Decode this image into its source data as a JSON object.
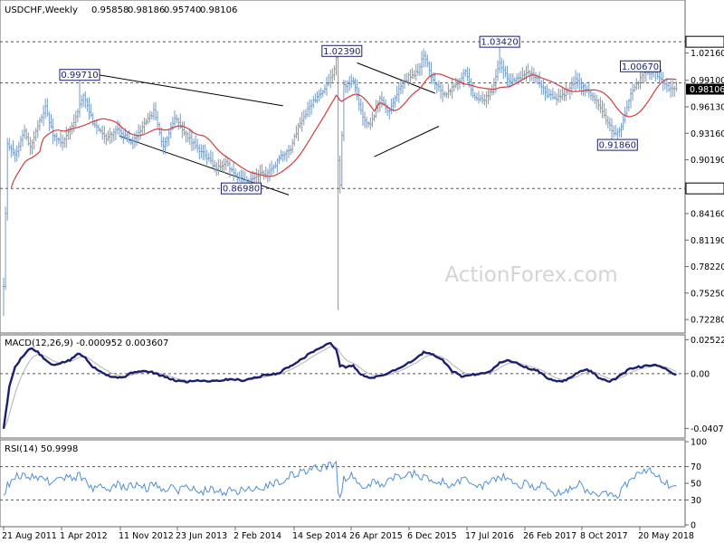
{
  "chart_data": {
    "type": "bar",
    "title": "USDCHF,Weekly",
    "ohlc": {
      "open": "0.95858",
      "high": "0.98186",
      "low": "0.95740",
      "close": "0.98106"
    },
    "watermark": "ActionForex.com",
    "x_labels": [
      "21 Aug 2011",
      "1 Apr 2012",
      "11 Nov 2012",
      "23 Jun 2013",
      "2 Feb 2014",
      "14 Sep 2014",
      "26 Apr 2015",
      "6 Dec 2015",
      "17 Jul 2016",
      "26 Feb 2017",
      "8 Oct 2017",
      "20 May 2018"
    ],
    "price": {
      "type": "ohlc-bar",
      "ylim": [
        0.7097,
        1.0587
      ],
      "ticks": [
        "1.03420",
        "1.02160",
        "0.99100",
        "0.96130",
        "0.93160",
        "0.90190",
        "0.86980",
        "0.84160",
        "0.81190",
        "0.78220",
        "0.75250",
        "0.72280"
      ],
      "current_price": "0.98106",
      "current_price_color": "#000000",
      "levels": [
        {
          "value": 1.0342,
          "label": "1.03420"
        },
        {
          "value": 0.9881,
          "label": ""
        },
        {
          "value": 0.8698,
          "label": "0.86980"
        }
      ],
      "annotations": [
        {
          "label": "0.99710",
          "week": 40,
          "value": 0.9971
        },
        {
          "label": "1.02390",
          "week": 178,
          "value": 1.0239
        },
        {
          "label": "1.03420",
          "week": 261,
          "value": 1.0342
        },
        {
          "label": "1.00670",
          "week": 335,
          "value": 1.0067
        },
        {
          "label": "0.91860",
          "week": 323,
          "value": 0.9186
        },
        {
          "label": "0.86980",
          "week": 125,
          "value": 0.8698
        }
      ],
      "trendlines": [
        {
          "from": [
            50,
            0.9971
          ],
          "to": [
            147,
            0.9625
          ]
        },
        {
          "from": [
            61,
            0.9285
          ],
          "to": [
            150,
            0.8625
          ]
        },
        {
          "from": [
            186,
            1.0105
          ],
          "to": [
            227,
            0.9765
          ]
        },
        {
          "from": [
            195,
            0.9053
          ],
          "to": [
            229,
            0.9395
          ]
        }
      ],
      "ma_label": "moving average",
      "series_color": "#7a9bbf",
      "ma_color": "#d43c3c",
      "anchors": [
        [
          0,
          0.761
        ],
        [
          2,
          0.92
        ],
        [
          6,
          0.907
        ],
        [
          11,
          0.935
        ],
        [
          14,
          0.915
        ],
        [
          18,
          0.94
        ],
        [
          22,
          0.961
        ],
        [
          26,
          0.93
        ],
        [
          31,
          0.92
        ],
        [
          37,
          0.945
        ],
        [
          42,
          0.976
        ],
        [
          47,
          0.944
        ],
        [
          54,
          0.925
        ],
        [
          60,
          0.938
        ],
        [
          67,
          0.92
        ],
        [
          72,
          0.935
        ],
        [
          79,
          0.956
        ],
        [
          84,
          0.916
        ],
        [
          90,
          0.95
        ],
        [
          96,
          0.93
        ],
        [
          102,
          0.915
        ],
        [
          107,
          0.905
        ],
        [
          112,
          0.891
        ],
        [
          117,
          0.9
        ],
        [
          122,
          0.883
        ],
        [
          128,
          0.878
        ],
        [
          133,
          0.885
        ],
        [
          139,
          0.887
        ],
        [
          146,
          0.905
        ],
        [
          151,
          0.915
        ],
        [
          156,
          0.944
        ],
        [
          162,
          0.965
        ],
        [
          168,
          0.98
        ],
        [
          173,
          0.995
        ],
        [
          175,
          1.015
        ],
        [
          176,
          0.9
        ],
        [
          177,
          0.875
        ],
        [
          179,
          0.985
        ],
        [
          184,
          0.99
        ],
        [
          189,
          0.95
        ],
        [
          193,
          0.94
        ],
        [
          198,
          0.97
        ],
        [
          203,
          0.955
        ],
        [
          208,
          0.98
        ],
        [
          213,
          0.995
        ],
        [
          218,
          1.0
        ],
        [
          221,
          1.02
        ],
        [
          226,
          0.99
        ],
        [
          232,
          0.975
        ],
        [
          238,
          0.985
        ],
        [
          243,
          1.0
        ],
        [
          248,
          0.97
        ],
        [
          253,
          0.97
        ],
        [
          257,
          0.98
        ],
        [
          261,
          1.01
        ],
        [
          266,
          0.99
        ],
        [
          271,
          0.992
        ],
        [
          276,
          1.0
        ],
        [
          281,
          0.992
        ],
        [
          286,
          0.975
        ],
        [
          291,
          0.97
        ],
        [
          296,
          0.977
        ],
        [
          301,
          0.992
        ],
        [
          306,
          0.981
        ],
        [
          309,
          0.975
        ],
        [
          314,
          0.96
        ],
        [
          317,
          0.948
        ],
        [
          321,
          0.93
        ],
        [
          325,
          0.938
        ],
        [
          329,
          0.97
        ],
        [
          333,
          0.987
        ],
        [
          337,
          0.999
        ],
        [
          342,
          1.0
        ],
        [
          347,
          0.988
        ],
        [
          350,
          0.982
        ],
        [
          354,
          0.981
        ]
      ]
    },
    "macd": {
      "label": "MACD(12,26,9) -0.000952 0.003607",
      "ylim": [
        -0.0465,
        0.0275
      ],
      "ticks": [
        "0.025224",
        "0.00",
        "-0.040702"
      ],
      "main_color": "#1a1f6e",
      "signal_color": "#b3b3b3",
      "anchors": [
        [
          0,
          -0.0407
        ],
        [
          3,
          -0.01
        ],
        [
          6,
          0.005
        ],
        [
          10,
          0.013
        ],
        [
          14,
          0.019
        ],
        [
          18,
          0.016
        ],
        [
          22,
          0.01
        ],
        [
          26,
          0.006
        ],
        [
          30,
          0.008
        ],
        [
          35,
          0.01
        ],
        [
          39,
          0.015
        ],
        [
          43,
          0.012
        ],
        [
          47,
          0.005
        ],
        [
          52,
          0.001
        ],
        [
          56,
          -0.002
        ],
        [
          60,
          -0.003
        ],
        [
          64,
          -0.002
        ],
        [
          68,
          0.001
        ],
        [
          72,
          0.002
        ],
        [
          78,
          0.001
        ],
        [
          84,
          -0.002
        ],
        [
          90,
          -0.005
        ],
        [
          96,
          -0.006
        ],
        [
          102,
          -0.005
        ],
        [
          108,
          -0.0055
        ],
        [
          114,
          -0.005
        ],
        [
          120,
          -0.004
        ],
        [
          126,
          -0.005
        ],
        [
          132,
          -0.003
        ],
        [
          138,
          -0.001
        ],
        [
          144,
          0.0
        ],
        [
          150,
          0.005
        ],
        [
          156,
          0.01
        ],
        [
          162,
          0.016
        ],
        [
          168,
          0.02
        ],
        [
          172,
          0.023
        ],
        [
          175,
          0.018
        ],
        [
          177,
          0.006
        ],
        [
          180,
          0.005
        ],
        [
          184,
          0.006
        ],
        [
          188,
          -0.001
        ],
        [
          193,
          -0.003
        ],
        [
          198,
          -0.002
        ],
        [
          203,
          0.001
        ],
        [
          208,
          0.004
        ],
        [
          213,
          0.008
        ],
        [
          218,
          0.012
        ],
        [
          221,
          0.016
        ],
        [
          226,
          0.014
        ],
        [
          231,
          0.01
        ],
        [
          236,
          0.002
        ],
        [
          241,
          -0.002
        ],
        [
          246,
          -0.001
        ],
        [
          251,
          0.0
        ],
        [
          256,
          0.002
        ],
        [
          261,
          0.008
        ],
        [
          266,
          0.01
        ],
        [
          271,
          0.007
        ],
        [
          276,
          0.004
        ],
        [
          281,
          0.002
        ],
        [
          286,
          -0.003
        ],
        [
          291,
          -0.006
        ],
        [
          296,
          -0.005
        ],
        [
          301,
          0.0
        ],
        [
          306,
          0.003
        ],
        [
          309,
          0.002
        ],
        [
          314,
          -0.004
        ],
        [
          319,
          -0.006
        ],
        [
          324,
          -0.002
        ],
        [
          329,
          0.003
        ],
        [
          334,
          0.005
        ],
        [
          339,
          0.006
        ],
        [
          344,
          0.006
        ],
        [
          349,
          0.003
        ],
        [
          354,
          -0.001
        ]
      ]
    },
    "rsi": {
      "label": "RSI(14) 50.9998",
      "ylim": [
        0,
        100
      ],
      "ticks": [
        "100",
        "70",
        "50",
        "30",
        "0"
      ],
      "levels": [
        70,
        30
      ],
      "color": "#4f8fd6",
      "anchors": [
        [
          0,
          38
        ],
        [
          4,
          55
        ],
        [
          8,
          60
        ],
        [
          12,
          57
        ],
        [
          16,
          60
        ],
        [
          20,
          56
        ],
        [
          24,
          52
        ],
        [
          28,
          54
        ],
        [
          32,
          58
        ],
        [
          36,
          55
        ],
        [
          40,
          60
        ],
        [
          44,
          50
        ],
        [
          48,
          42
        ],
        [
          52,
          46
        ],
        [
          56,
          44
        ],
        [
          60,
          48
        ],
        [
          64,
          44
        ],
        [
          68,
          48
        ],
        [
          72,
          47
        ],
        [
          76,
          44
        ],
        [
          80,
          49
        ],
        [
          84,
          43
        ],
        [
          88,
          47
        ],
        [
          92,
          42
        ],
        [
          96,
          46
        ],
        [
          100,
          43
        ],
        [
          104,
          40
        ],
        [
          108,
          44
        ],
        [
          112,
          40
        ],
        [
          116,
          38
        ],
        [
          120,
          44
        ],
        [
          124,
          40
        ],
        [
          128,
          43
        ],
        [
          132,
          42
        ],
        [
          136,
          45
        ],
        [
          140,
          49
        ],
        [
          144,
          52
        ],
        [
          148,
          56
        ],
        [
          152,
          60
        ],
        [
          156,
          62
        ],
        [
          160,
          66
        ],
        [
          164,
          70
        ],
        [
          168,
          68
        ],
        [
          172,
          72
        ],
        [
          175,
          75
        ],
        [
          176,
          38
        ],
        [
          177,
          34
        ],
        [
          179,
          56
        ],
        [
          183,
          60
        ],
        [
          187,
          50
        ],
        [
          191,
          46
        ],
        [
          195,
          52
        ],
        [
          199,
          48
        ],
        [
          203,
          56
        ],
        [
          207,
          60
        ],
        [
          211,
          57
        ],
        [
          215,
          62
        ],
        [
          219,
          60
        ],
        [
          223,
          54
        ],
        [
          227,
          49
        ],
        [
          231,
          52
        ],
        [
          235,
          47
        ],
        [
          239,
          51
        ],
        [
          243,
          55
        ],
        [
          247,
          50
        ],
        [
          251,
          46
        ],
        [
          255,
          52
        ],
        [
          259,
          56
        ],
        [
          263,
          58
        ],
        [
          267,
          52
        ],
        [
          271,
          47
        ],
        [
          275,
          50
        ],
        [
          279,
          44
        ],
        [
          283,
          48
        ],
        [
          287,
          42
        ],
        [
          291,
          38
        ],
        [
          295,
          41
        ],
        [
          299,
          45
        ],
        [
          303,
          48
        ],
        [
          307,
          42
        ],
        [
          311,
          38
        ],
        [
          315,
          36
        ],
        [
          319,
          40
        ],
        [
          323,
          35
        ],
        [
          327,
          48
        ],
        [
          331,
          56
        ],
        [
          335,
          64
        ],
        [
          339,
          66
        ],
        [
          343,
          60
        ],
        [
          347,
          54
        ],
        [
          351,
          44
        ],
        [
          354,
          51
        ]
      ]
    }
  }
}
